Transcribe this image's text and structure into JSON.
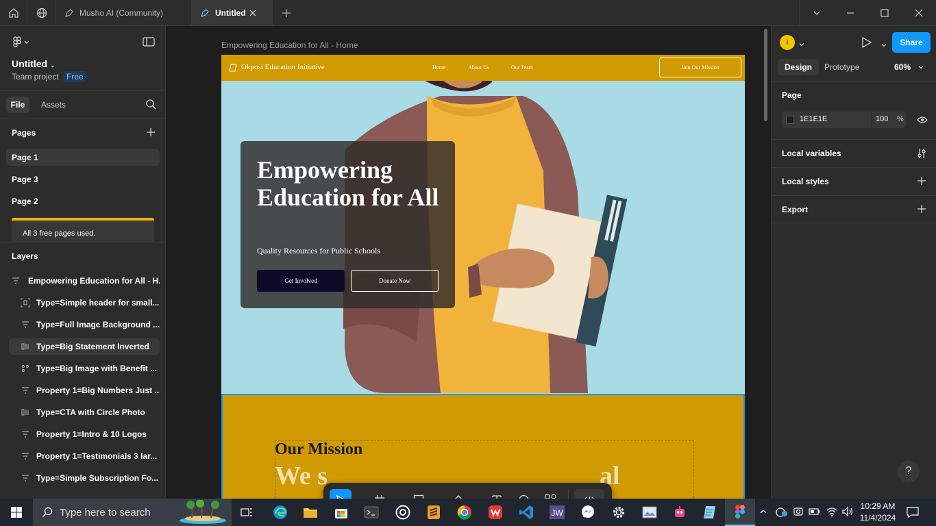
{
  "tabs": {
    "community": "Musho AI (Community)",
    "untitled": "Untitled"
  },
  "left": {
    "file_name": "Untitled",
    "team": "Team project",
    "plan_badge": "Free",
    "tab_file": "File",
    "tab_assets": "Assets",
    "pages_heading": "Pages",
    "pages": [
      "Page 1",
      "Page 3",
      "Page 2"
    ],
    "pages_notice": "All 3 free pages used.",
    "layers_heading": "Layers",
    "layers": [
      "Empowering Education for All - H...",
      "Type=Simple header for small...",
      "Type=Full Image Background ...",
      "Type=Big Statement Inverted",
      "Type=Big Image with Benefit ...",
      "Property 1=Big Numbers Just ...",
      "Type=CTA with Circle Photo",
      "Property 1=Intro & 10 Logos",
      "Property 1=Testimonials 3 lar...",
      "Type=Simple Subscription Fo..."
    ]
  },
  "canvas": {
    "frame_label": "Empowering Education for All - Home",
    "site": {
      "logo_text": "Okposi Education Initiative",
      "nav": [
        "Home",
        "About Us",
        "Our Team"
      ],
      "cta": "Join Our Mission",
      "hero_title": "Empowering Education for All",
      "hero_subtitle": "Quality Resources for Public Schools",
      "btn_primary": "Get Involved",
      "btn_secondary": "Donate Now",
      "mission_heading": "Our Mission",
      "mission_big_start": "We s",
      "mission_big_end": "al"
    }
  },
  "right": {
    "avatar_initial": "I",
    "share": "Share",
    "tab_design": "Design",
    "tab_prototype": "Prototype",
    "zoom": "60%",
    "page_heading": "Page",
    "bg_color": "1E1E1E",
    "bg_opacity": "100",
    "percent": "%",
    "local_variables": "Local variables",
    "local_styles": "Local styles",
    "export": "Export",
    "help": "?"
  },
  "taskbar": {
    "search_placeholder": "Type here to search",
    "time": "10:29 AM",
    "date": "11/4/2024"
  },
  "colors": {
    "accent_blue": "#0d99ff",
    "site_gold": "#d19a00",
    "hero_sky": "#a8dbe4",
    "notice_yellow": "#f0b400"
  }
}
